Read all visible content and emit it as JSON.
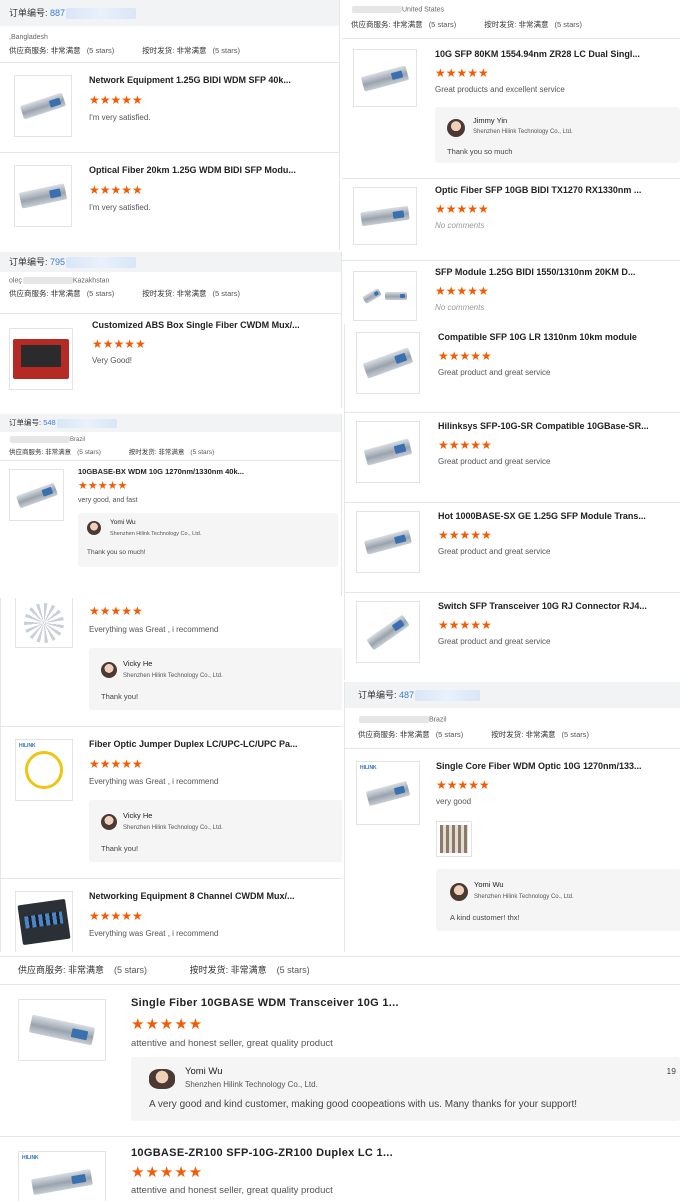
{
  "common": {
    "order_label": "订单编号:",
    "supplier_service": "供应商服务:",
    "very_satisfied": "非常满意",
    "five_stars": "(5 stars)",
    "on_time": "按时发货:",
    "stars": "★★★★★",
    "company": "Shenzhen Hilink Technology Co., Ltd."
  },
  "left": {
    "order1": {
      "number": "887",
      "country": ",Bangladesh",
      "items": [
        {
          "title": "Network Equipment 1.25G BIDI WDM SFP 40k...",
          "comment": "I'm very satisfied."
        },
        {
          "title": "Optical Fiber 20km 1.25G WDM BIDI SFP Modu...",
          "comment": "I'm very satisfied."
        }
      ]
    },
    "order2": {
      "number": "795",
      "customer": "oleç",
      "country": "Kazakhstan",
      "items": [
        {
          "title": "Customized ABS Box Single Fiber CWDM Mux/...",
          "comment": "Very Good!"
        }
      ]
    },
    "order3": {
      "number": "548",
      "country": "Brazil",
      "items": [
        {
          "title": "10GBASE-BX WDM 10G 1270nm/1330nm 40k...",
          "comment": "very good, and fast",
          "reply_name": "Yomi Wu",
          "reply_text": "Thank you so much!"
        }
      ]
    },
    "order4": {
      "items": [
        {
          "comment": "Everything was Great , i recommend",
          "reply_name": "Vicky He",
          "reply_text": "Thank you!"
        },
        {
          "title": "Fiber Optic Jumper Duplex LC/UPC-LC/UPC Pa...",
          "comment": "Everything was Great , i recommend",
          "reply_name": "Vicky He",
          "reply_text": "Thank you!"
        },
        {
          "title": "Networking Equipment 8 Channel CWDM Mux/...",
          "comment": "Everything was Great , i recommend"
        }
      ]
    }
  },
  "right": {
    "order1": {
      "country": "United States",
      "items": [
        {
          "title": "10G SFP 80KM 1554.94nm ZR28 LC Dual Singl...",
          "comment": "Great products and excellent service",
          "reply_name": "Jimmy Yin",
          "reply_text": "Thank you so much"
        },
        {
          "title": "Optic Fiber SFP 10GB BIDI TX1270 RX1330nm ...",
          "comment": "No comments"
        },
        {
          "title": "SFP Module 1.25G BIDI 1550/1310nm 20KM D...",
          "comment": "No comments"
        }
      ]
    },
    "order2": {
      "items": [
        {
          "title": "Compatible SFP 10G LR 1310nm 10km module",
          "comment": "Great product and great service"
        },
        {
          "title": "Hilinksys SFP-10G-SR Compatible 10GBase-SR...",
          "comment": "Great product and great service"
        },
        {
          "title": "Hot 1000BASE-SX GE 1.25G SFP Module Trans...",
          "comment": "Great product and great service"
        },
        {
          "title": "Switch SFP Transceiver 10G RJ Connector RJ4...",
          "comment": "Great product and great service"
        }
      ]
    },
    "order3": {
      "number": "487",
      "country": "Brazil",
      "items": [
        {
          "title": "Single Core Fiber WDM Optic 10G 1270nm/133...",
          "comment": "very good",
          "reply_name": "Yomi Wu",
          "reply_text": "A kind customer! thx!"
        }
      ]
    }
  },
  "bottom": {
    "items": [
      {
        "title": "Single Fiber 10GBASE WDM Transceiver 10G 1...",
        "comment": "attentive and honest seller, great quality product",
        "reply_name": "Yomi Wu",
        "reply_date": "19",
        "reply_text": "A very good and kind customer,  making good coopeations with us. Many thanks for your support!"
      },
      {
        "title": "10GBASE-ZR100 SFP-10G-ZR100 Duplex LC 1...",
        "comment": "attentive and honest seller, great quality product"
      }
    ]
  },
  "logo_text": "HILINK"
}
